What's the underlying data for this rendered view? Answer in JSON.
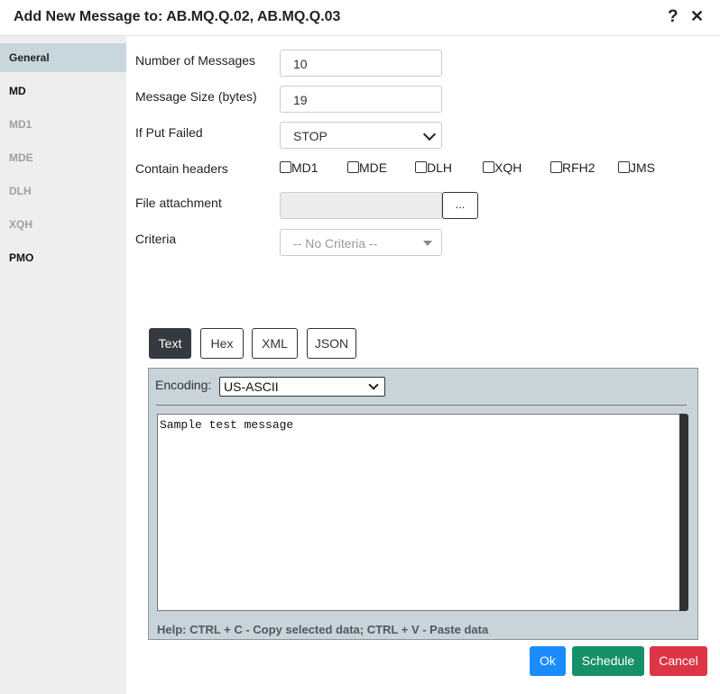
{
  "dialog": {
    "title": "Add New Message to: AB.MQ.Q.02, AB.MQ.Q.03",
    "help": "?",
    "close": "✕"
  },
  "sidebar": {
    "items": [
      {
        "label": "General",
        "state": "active"
      },
      {
        "label": "MD",
        "state": "enabled"
      },
      {
        "label": "MD1",
        "state": "disabled"
      },
      {
        "label": "MDE",
        "state": "disabled"
      },
      {
        "label": "DLH",
        "state": "disabled"
      },
      {
        "label": "XQH",
        "state": "disabled"
      },
      {
        "label": "PMO",
        "state": "enabled"
      }
    ]
  },
  "form": {
    "num_messages": {
      "label": "Number of Messages",
      "value": "10"
    },
    "msg_size": {
      "label": "Message Size (bytes)",
      "value": "19"
    },
    "if_put_failed": {
      "label": "If Put Failed",
      "value": "STOP"
    },
    "contain_headers": {
      "label": "Contain headers",
      "options": [
        "MD1",
        "MDE",
        "DLH",
        "XQH",
        "RFH2",
        "JMS"
      ]
    },
    "file_attachment": {
      "label": "File attachment",
      "button": "..."
    },
    "criteria": {
      "label": "Criteria",
      "placeholder": "-- No Criteria --"
    }
  },
  "tabs": [
    "Text",
    "Hex",
    "XML",
    "JSON"
  ],
  "active_tab": "Text",
  "editor": {
    "encoding_label": "Encoding:",
    "encoding_value": "US-ASCII",
    "content": "Sample test message",
    "help": "Help: CTRL + C - Copy selected data; CTRL + V - Paste data"
  },
  "buttons": {
    "ok": "Ok",
    "schedule": "Schedule",
    "cancel": "Cancel"
  },
  "colors": {
    "ok": "#1a8cff",
    "schedule": "#17906a",
    "cancel": "#dc3545",
    "sidebar_active": "#c8d6dd",
    "editor_bg": "#c8d4d9"
  }
}
